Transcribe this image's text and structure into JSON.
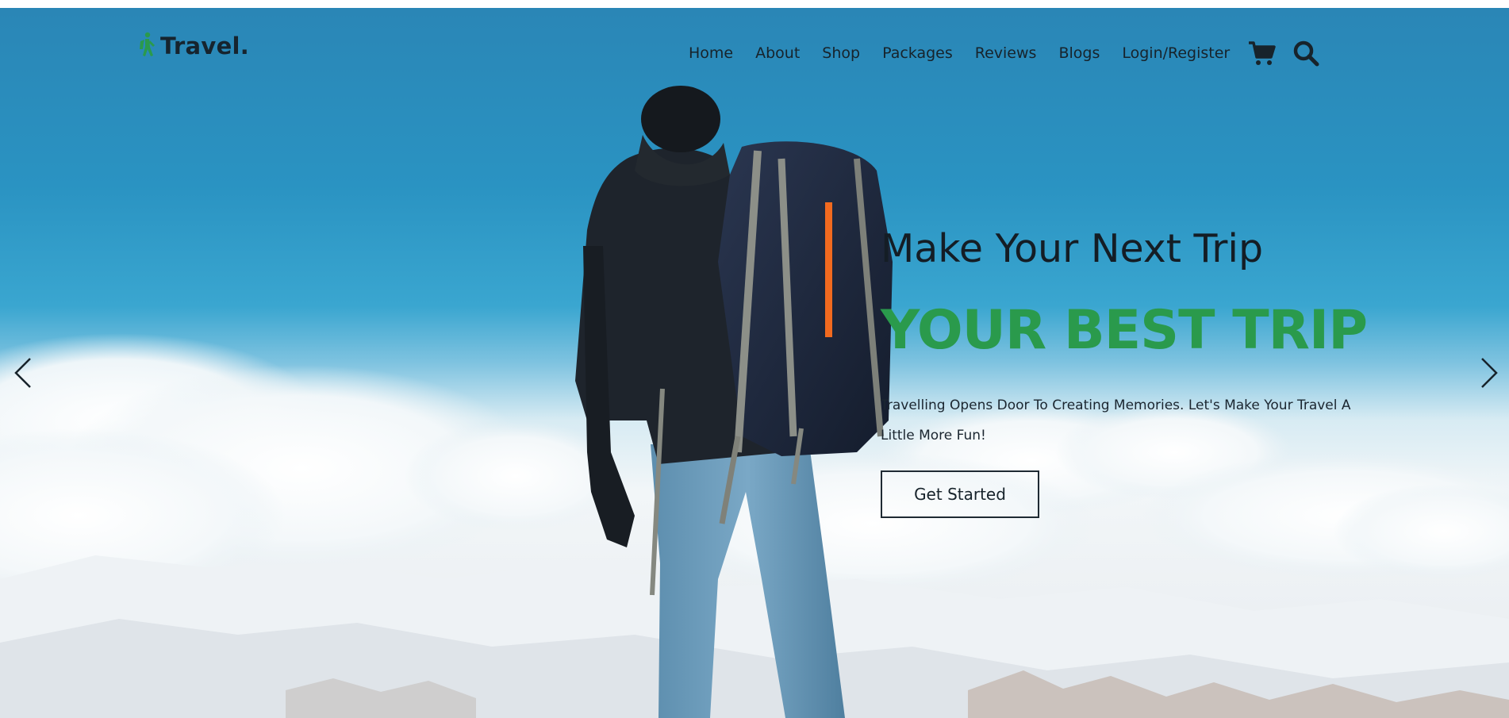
{
  "header": {
    "logo_text": "Travel.",
    "logo_icon": "hiker-icon",
    "nav": [
      "Home",
      "About",
      "Shop",
      "Packages",
      "Reviews",
      "Blogs",
      "Login/Register"
    ],
    "cart_icon": "cart-icon",
    "search_icon": "search-icon"
  },
  "hero": {
    "title": "Make Your Next Trip",
    "highlight": "YOUR BEST TRIP",
    "description": "Travelling Opens Door To Creating Memories. Let's Make Your Travel A Little More Fun!",
    "cta_label": "Get Started",
    "prev_icon": "chevron-left-icon",
    "next_icon": "chevron-right-icon"
  },
  "colors": {
    "accent": "#2a9a4c",
    "text_dark": "#17232b",
    "sky": "#2a93c2"
  }
}
